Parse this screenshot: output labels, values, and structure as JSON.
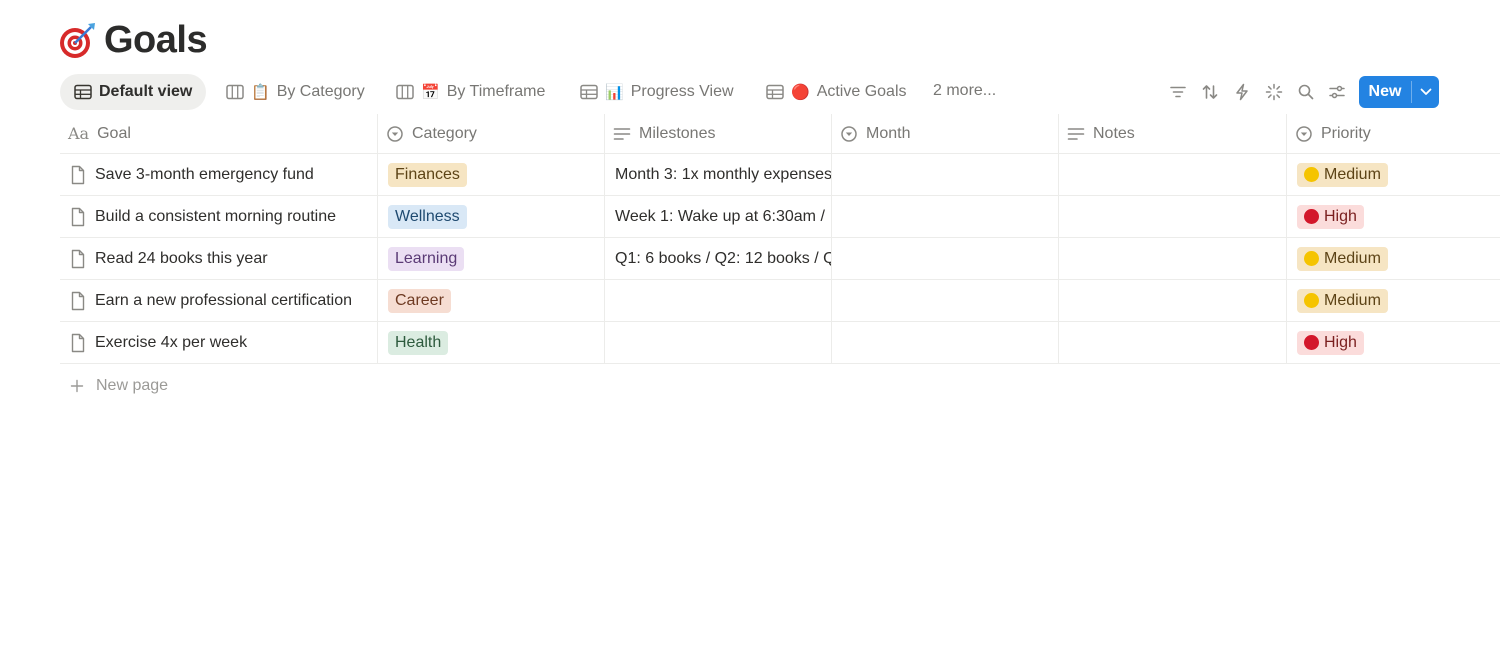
{
  "page": {
    "title": "Goals",
    "title_icon": "dart-target-icon"
  },
  "views": {
    "tabs": [
      {
        "label": "Default view",
        "icon": "table-icon",
        "emoji": "",
        "active": true
      },
      {
        "label": "By Category",
        "icon": "board-icon",
        "emoji": "📋",
        "active": false
      },
      {
        "label": "By Timeframe",
        "icon": "board-icon",
        "emoji": "📅",
        "active": false
      },
      {
        "label": "Progress View",
        "icon": "table-icon",
        "emoji": "📊",
        "active": false
      },
      {
        "label": "Active Goals",
        "icon": "table-icon",
        "emoji": "🔴",
        "active": false
      }
    ],
    "more_label": "2 more..."
  },
  "toolbar": {
    "icons": [
      "filter-icon",
      "sort-icon",
      "automation-icon",
      "ai-sparkle-icon",
      "search-icon",
      "settings-icon"
    ],
    "new_label": "New"
  },
  "table": {
    "columns": [
      {
        "label": "Goal",
        "icon": "title-icon"
      },
      {
        "label": "Category",
        "icon": "select-icon"
      },
      {
        "label": "Milestones",
        "icon": "text-icon"
      },
      {
        "label": "Month",
        "icon": "select-icon"
      },
      {
        "label": "Notes",
        "icon": "text-icon"
      },
      {
        "label": "Priority",
        "icon": "select-icon"
      }
    ],
    "rows": [
      {
        "goal": "Save 3-month emergency fund",
        "category": "Finances",
        "milestones": "Month 3: 1x monthly expenses",
        "month": "",
        "notes": "",
        "priority": "Medium"
      },
      {
        "goal": "Build a consistent morning routine",
        "category": "Wellness",
        "milestones": "Week 1: Wake up at 6:30am / ",
        "month": "",
        "notes": "",
        "priority": "High"
      },
      {
        "goal": "Read 24 books this year",
        "category": "Learning",
        "milestones": "Q1: 6 books / Q2: 12 books / Q",
        "month": "",
        "notes": "",
        "priority": "Medium"
      },
      {
        "goal": "Earn a new professional certification",
        "category": "Career",
        "milestones": "",
        "month": "",
        "notes": "",
        "priority": "Medium"
      },
      {
        "goal": "Exercise 4x per week",
        "category": "Health",
        "milestones": "",
        "month": "",
        "notes": "",
        "priority": "High"
      }
    ],
    "new_page_label": "New page"
  },
  "colors": {
    "accent": "#2383e2",
    "category": {
      "Finances": {
        "bg": "#f6e5c3",
        "fg": "#5c4316"
      },
      "Wellness": {
        "bg": "#d9e8f6",
        "fg": "#1f4a70"
      },
      "Learning": {
        "bg": "#ebdff3",
        "fg": "#5a3a75"
      },
      "Career": {
        "bg": "#f6ddd2",
        "fg": "#6e3a22"
      },
      "Health": {
        "bg": "#dbece1",
        "fg": "#2d5a3d"
      }
    },
    "priority": {
      "Medium": {
        "bg": "#f6e5c3",
        "fg": "#5c4316",
        "dot": "#f5c400"
      },
      "High": {
        "bg": "#fbdcdb",
        "fg": "#7a1f1f",
        "dot": "#d3172b"
      }
    }
  }
}
